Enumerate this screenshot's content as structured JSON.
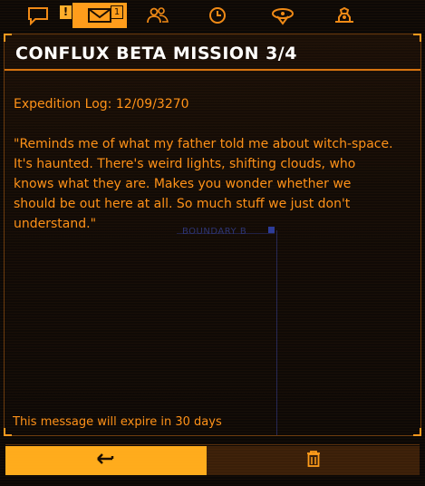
{
  "tabs": [
    {
      "name": "chat",
      "icon": "chat-icon",
      "badge": "!"
    },
    {
      "name": "inbox",
      "icon": "envelope-icon",
      "badge": "1",
      "active": true
    },
    {
      "name": "contacts",
      "icon": "contacts-icon"
    },
    {
      "name": "history",
      "icon": "clock-icon"
    },
    {
      "name": "navigation",
      "icon": "nav-beacon-icon"
    },
    {
      "name": "settings",
      "icon": "gear-icon"
    }
  ],
  "message": {
    "title": "CONFLUX BETA MISSION 3/4",
    "log": "Expedition Log: 12/09/3270",
    "body": "\"Reminds me of what my father told me about witch-space. It's haunted. There's weird lights, shifting clouds, who knows what they are. Makes you wonder whether we should be out here at all. So much stuff we just don't understand.\"",
    "overlay_label": "BOUNDARY B",
    "expiry": "This message will expire in 30 days"
  },
  "actions": {
    "reply_icon": "reply-arrow-icon",
    "delete_icon": "trash-icon"
  },
  "colors": {
    "accent": "#ff9d1b",
    "text": "#ff9218",
    "title": "#ffffff",
    "background": "#0b0806"
  }
}
